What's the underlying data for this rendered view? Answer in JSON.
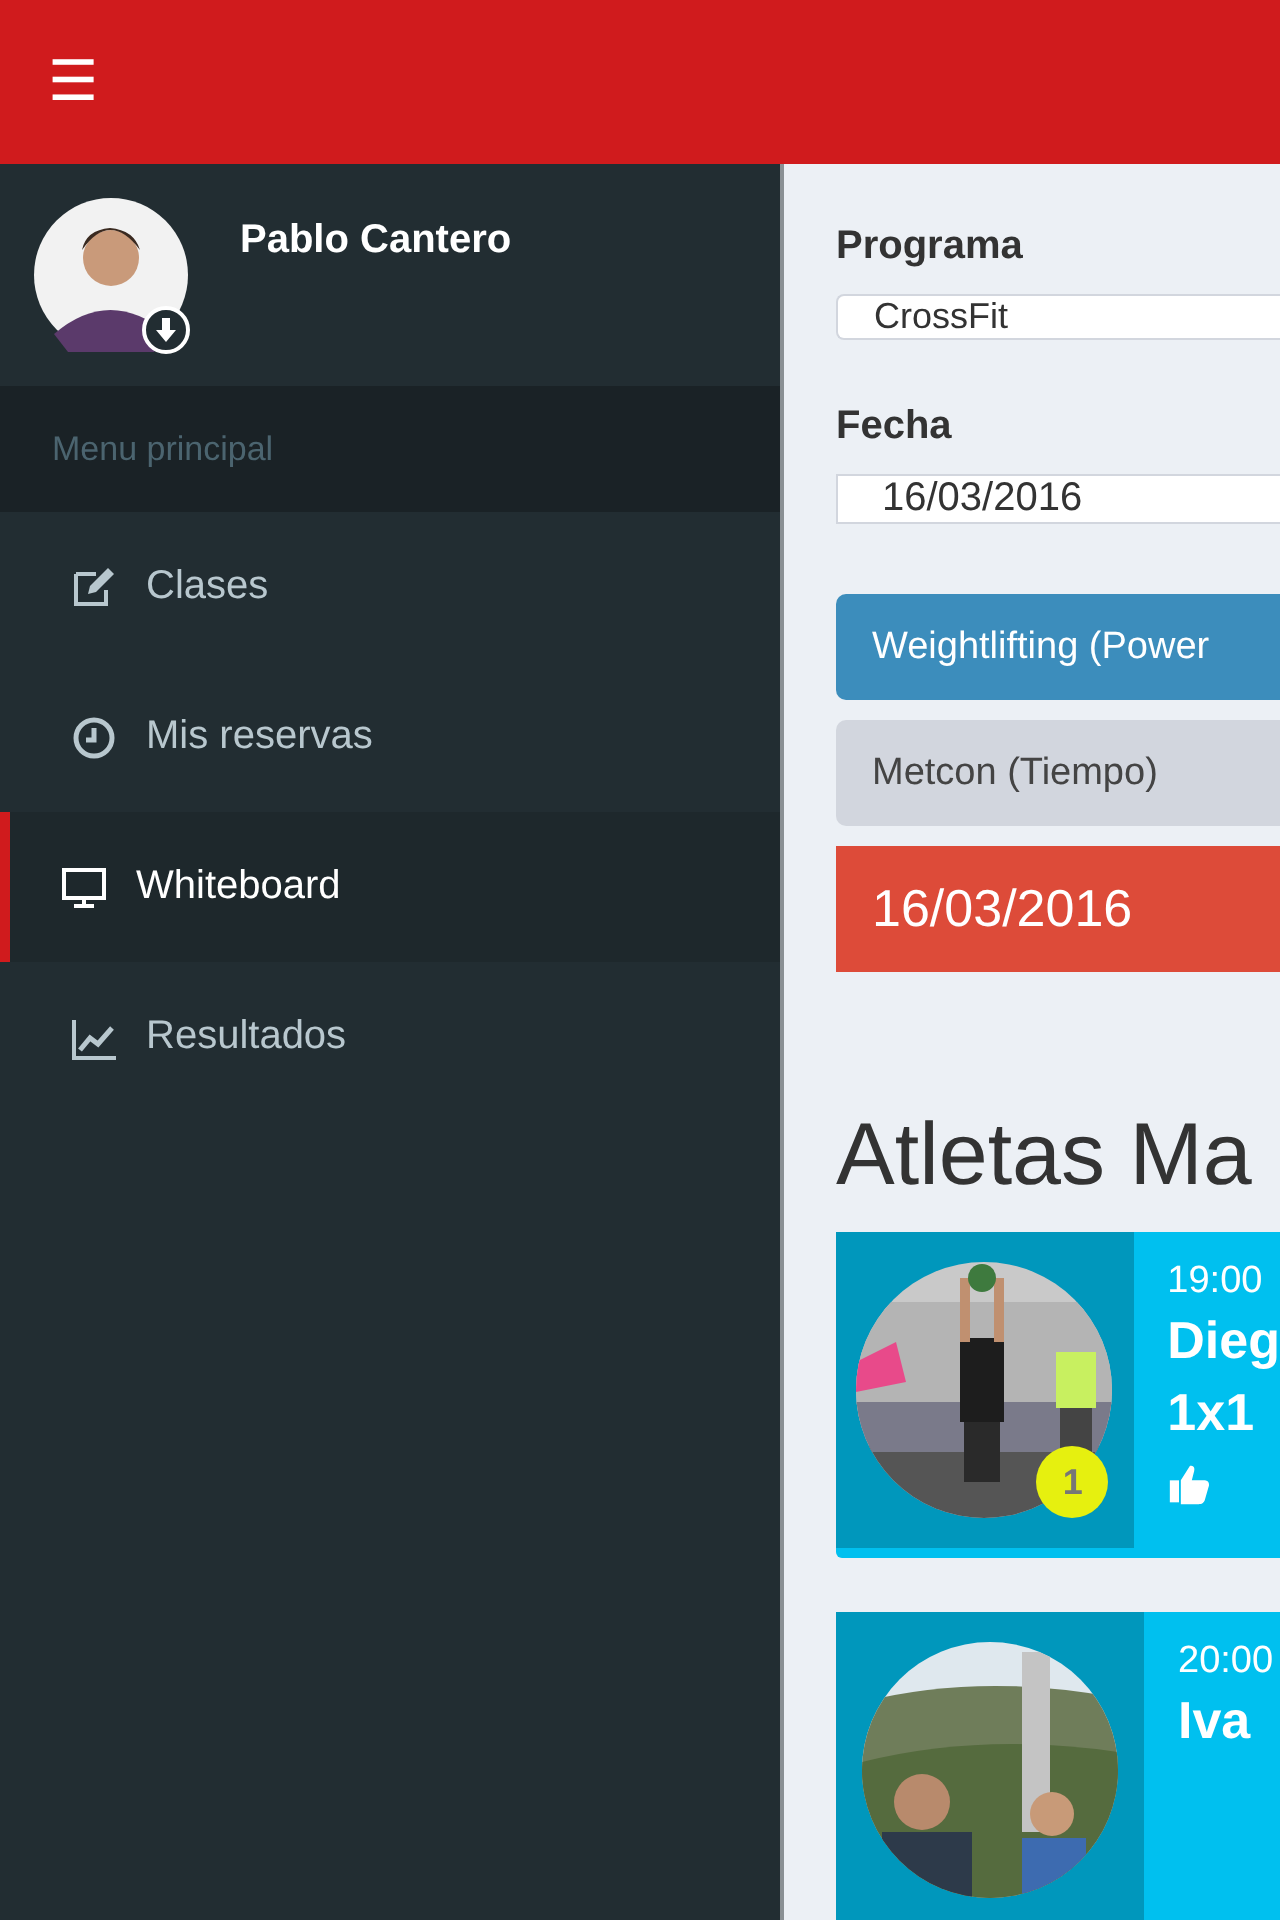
{
  "header": {
    "menu_icon": "☰"
  },
  "sidebar": {
    "user": {
      "name": "Pablo Cantero"
    },
    "section_title": "Menu principal",
    "items": [
      {
        "label": "Clases",
        "selected": false
      },
      {
        "label": "Mis reservas",
        "selected": false
      },
      {
        "label": "Whiteboard",
        "selected": true
      },
      {
        "label": "Resultados",
        "selected": false
      }
    ]
  },
  "form": {
    "program_label": "Programa",
    "program_value": "CrossFit",
    "date_label": "Fecha",
    "date_value": "16/03/2016"
  },
  "workouts": [
    {
      "label": "Weightlifting (Power",
      "kind": "primary"
    },
    {
      "label": "Metcon (Tiempo)",
      "kind": "default"
    },
    {
      "label": "16/03/2016",
      "kind": "date"
    }
  ],
  "athletes": {
    "title": "Atletas Ma",
    "cards": [
      {
        "rank": "1",
        "time": "19:00",
        "name": "Dieg",
        "result": "1x1",
        "liked": true
      },
      {
        "time": "20:00",
        "name": "Iva",
        "liked": false
      }
    ]
  }
}
